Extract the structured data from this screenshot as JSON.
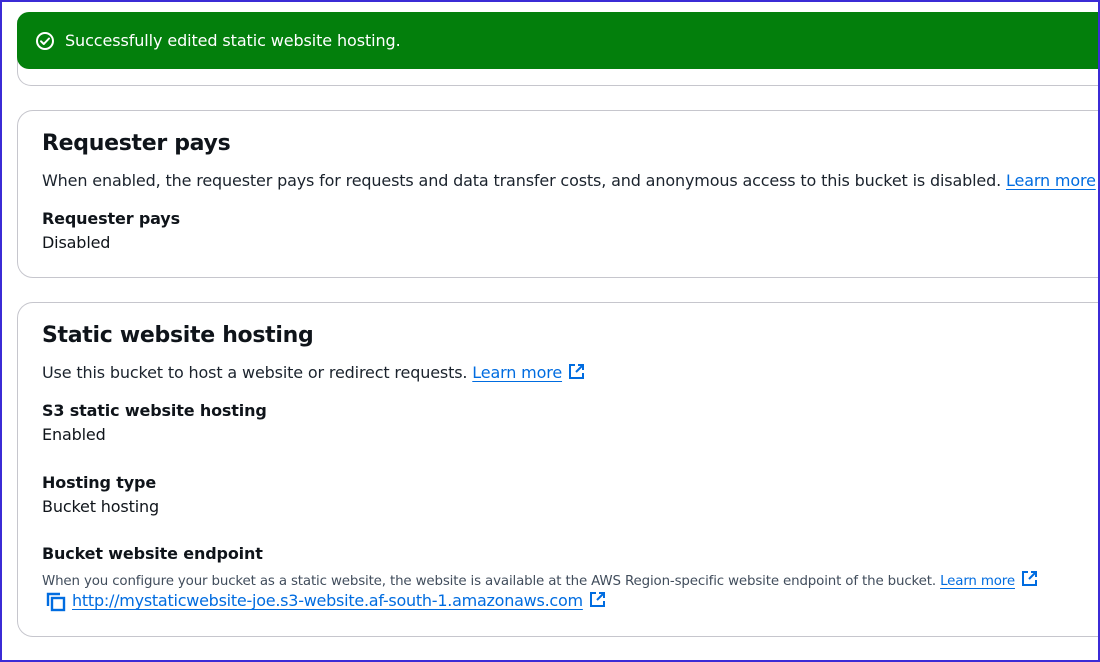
{
  "flash": {
    "message": "Successfully edited static website hosting.",
    "icon": "check-circle-icon",
    "color": "#037f0c"
  },
  "requester_pays": {
    "title": "Requester pays",
    "description": "When enabled, the requester pays for requests and data transfer costs, and anonymous access to this bucket is disabled.",
    "learn_more": "Learn more",
    "field_label": "Requester pays",
    "field_value": "Disabled"
  },
  "static_hosting": {
    "title": "Static website hosting",
    "description": "Use this bucket to host a website or redirect requests.",
    "learn_more": "Learn more",
    "fields": [
      {
        "label": "S3 static website hosting",
        "value": "Enabled"
      },
      {
        "label": "Hosting type",
        "value": "Bucket hosting"
      }
    ],
    "endpoint": {
      "label": "Bucket website endpoint",
      "description": "When you configure your bucket as a static website, the website is available at the AWS Region-specific website endpoint of the bucket.",
      "learn_more": "Learn more",
      "url": "http://mystaticwebsite-joe.s3-website.af-south-1.amazonaws.com"
    }
  },
  "colors": {
    "link": "#006ce0",
    "border": "#c6c6cd",
    "success": "#037f0c"
  }
}
